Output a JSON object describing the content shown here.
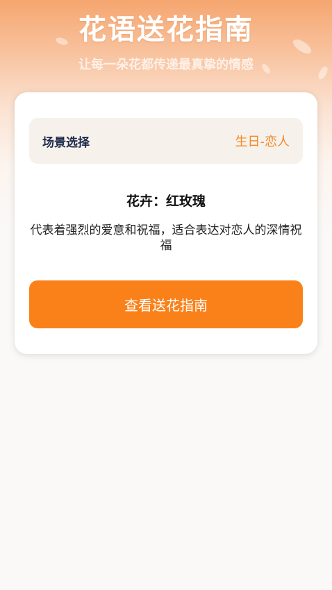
{
  "header": {
    "title": "花语送花指南",
    "subtitle": "让每一朵花都传递最真挚的情感"
  },
  "scene": {
    "label": "场景选择",
    "value": "生日-恋人"
  },
  "flower": {
    "name": "花卉：红玫瑰",
    "description": "代表着强烈的爱意和祝福，适合表达对恋人的深情祝福"
  },
  "action": {
    "button_label": "查看送花指南"
  },
  "colors": {
    "accent": "#fa8119",
    "scene_value": "#f08a2a",
    "scene_label": "#1d2b4a"
  }
}
